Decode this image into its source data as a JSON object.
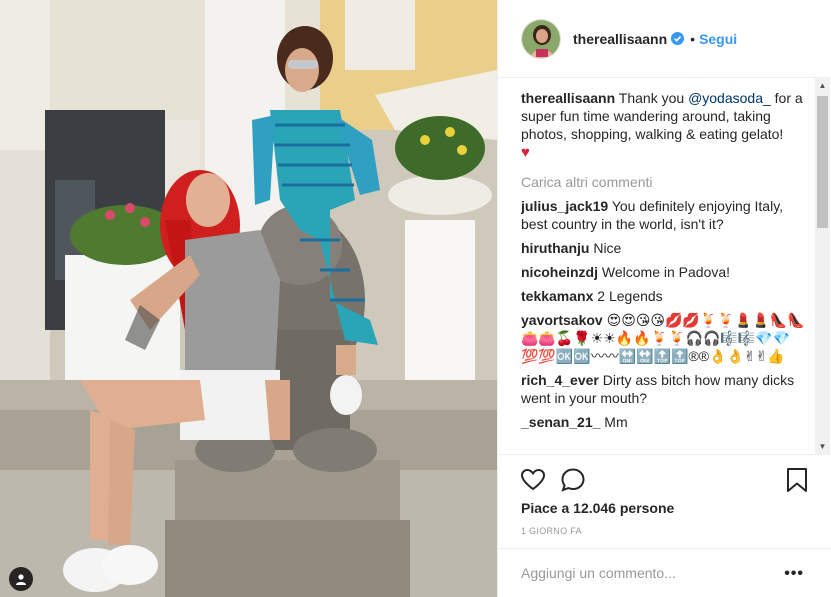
{
  "post": {
    "author": "thereallisaann",
    "follow_label": "Segui",
    "separator": "•",
    "caption": {
      "username": "thereallisaann",
      "text_before": "Thank you ",
      "mention": "@yodasoda_",
      "text_after": " for a super fun time wandering around, taking photos, shopping, walking & eating gelato!",
      "emoji": "♥"
    },
    "load_more": "Carica altri commenti",
    "comments": [
      {
        "username": "julius_jack19",
        "text": "You definitely enjoying Italy, best country in the world, isn't it?"
      },
      {
        "username": "hiruthanju",
        "text": "Nice"
      },
      {
        "username": "nicoheinzdj",
        "text": "Welcome in Padova!"
      },
      {
        "username": "tekkamanx",
        "text": "2 Legends"
      },
      {
        "username": "yavortsakov",
        "text": "😍😍😘😘💋💋🍹🍹💄💄👠👠👛👛🍒🌹☀☀🔥🔥🍹🍹🎧🎧🎼🎼💎💎💯💯🆗🆗〰〰🔛🔛🔝🔝®®👌👌✌✌👍"
      },
      {
        "username": "rich_4_ever",
        "text": "Dirty ass bitch how many dicks went in your mouth?"
      },
      {
        "username": "_senan_21_",
        "text": "Mm"
      }
    ],
    "likes_text": "Piace a 12.046 persone",
    "time_text": "1 GIORNO FA",
    "add_comment_placeholder": "Aggiungi un commento...",
    "more_label": "•••"
  },
  "colors": {
    "accent": "#3897f0",
    "text": "#262626",
    "muted": "#999999",
    "divider": "#efefef"
  },
  "icons": {
    "like": "heart-icon",
    "comment": "comment-bubble-icon",
    "save": "bookmark-icon",
    "verified": "verified-badge-icon",
    "tag": "user-tag-icon"
  }
}
